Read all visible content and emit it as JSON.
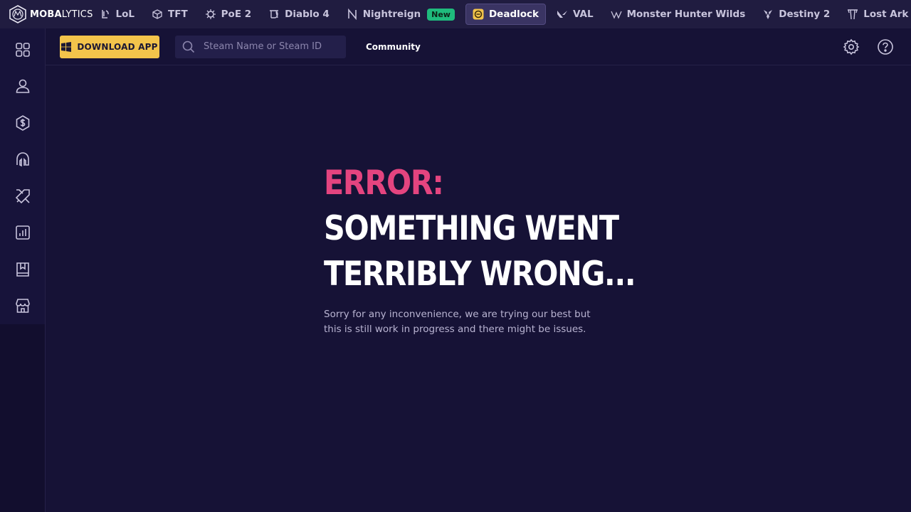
{
  "brand": {
    "name_bold": "MOBA",
    "name_light": "LYTICS"
  },
  "colors": {
    "accent": "#f3c44b",
    "error": "#e4447f",
    "new_badge": "#1fbb7d",
    "background": "#161236"
  },
  "games": [
    {
      "label": "LoL",
      "icon": "lol-icon"
    },
    {
      "label": "TFT",
      "icon": "tft-icon"
    },
    {
      "label": "PoE 2",
      "icon": "poe2-icon"
    },
    {
      "label": "Diablo 4",
      "icon": "diablo4-icon"
    },
    {
      "label": "Nightreign",
      "icon": "nightreign-icon",
      "badge": "New"
    },
    {
      "label": "Deadlock",
      "icon": "deadlock-icon",
      "active": true
    },
    {
      "label": "VAL",
      "icon": "valorant-icon"
    },
    {
      "label": "Monster Hunter Wilds",
      "icon": "mhw-icon"
    },
    {
      "label": "Destiny 2",
      "icon": "destiny2-icon"
    },
    {
      "label": "Lost Ark",
      "icon": "lostark-icon"
    }
  ],
  "sidebar": {
    "items": [
      {
        "icon": "dashboard-grid-icon"
      },
      {
        "icon": "profile-icon"
      },
      {
        "icon": "currency-shield-icon"
      },
      {
        "icon": "heroes-helmet-icon"
      },
      {
        "icon": "builds-swords-icon"
      },
      {
        "icon": "stats-chart-icon"
      },
      {
        "icon": "guides-book-icon"
      },
      {
        "icon": "store-icon"
      }
    ]
  },
  "header": {
    "download_label": "DOWNLOAD APP",
    "search_placeholder": "Steam Name or Steam ID",
    "community_label": "Community"
  },
  "error": {
    "line1": "ERROR:",
    "line2": "SOMETHING WENT",
    "line3": "TERRIBLY WRONG...",
    "message": "Sorry for any inconvenience, we are trying our best but this is still work in progress and there might be issues."
  }
}
